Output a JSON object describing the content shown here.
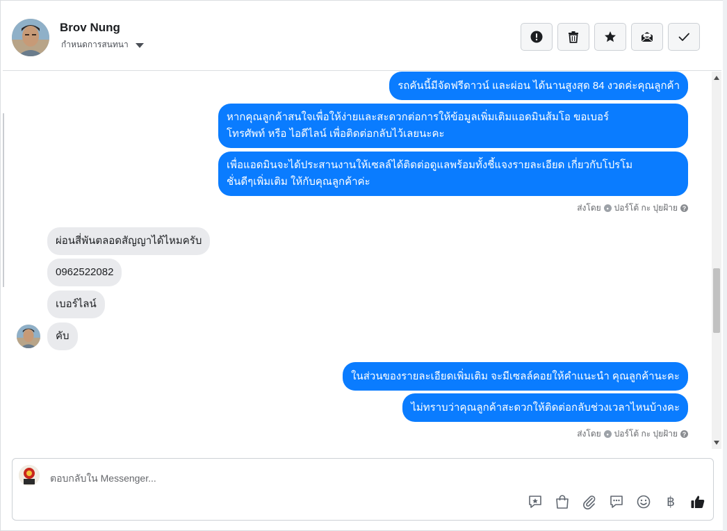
{
  "header": {
    "contact_name": "Brov Nung",
    "assign_label": "กำหนดการสนทนา",
    "actions": [
      {
        "name": "mark-spam",
        "icon": "exclamation-icon"
      },
      {
        "name": "delete",
        "icon": "trash-icon"
      },
      {
        "name": "star",
        "icon": "star-icon"
      },
      {
        "name": "mark-unread",
        "icon": "envelope-icon"
      },
      {
        "name": "mark-done",
        "icon": "check-icon"
      }
    ]
  },
  "messages": {
    "out1": "รถคันนี้มีจัดฟรีดาวน์ และผ่อน ได้นานสูงสุด 84 งวดค่ะคุณลูกค้า",
    "out2_line1": "หากคุณลูกค้าสนใจเพื่อให้ง่ายและสะดวกต่อการให้ข้อมูลเพิ่มเติมแอดมินส้มโอ ขอเบอร์",
    "out2_line2": "โทรศัพท์ หรือ ไอดีไลน์ เพื่อติดต่อกลับไว้เลยนะคะ",
    "out3_line1": "เพื่อแอดมินจะได้ประสานงานให้เซลล์ได้ติดต่อดูแลพร้อมทั้งชี้แจงรายละเอียด เกี่ยวกับโปรโม",
    "out3_line2": "ชั่นดีๆเพิ่มเติม ให้กับคุณลูกค้าค่ะ",
    "sent_by_1": "ส่งโดย",
    "sent_by_1_name": "ปอร์โต้ กะ ปุยฝ้าย",
    "in1": "ผ่อนสี่พันตลอดสัญญาได้ไหมครับ",
    "in2": "0962522082",
    "in3": "เบอร์ไลน์",
    "in4": "คับ",
    "out4": "ในส่วนของรายละเอียดเพิ่มเติม จะมีเซลล์คอยให้คำแนะนำ คุณลูกค้านะคะ",
    "out5": "ไม่ทราบว่าคุณลูกค้าสะดวกให้ติดต่อกลับช่วงเวลาไหนบ้างคะ",
    "sent_by_2": "ส่งโดย",
    "sent_by_2_name": "ปอร์โต้ กะ ปุยฝ้าย"
  },
  "composer": {
    "placeholder": "ตอบกลับใน Messenger...",
    "tools": [
      "saved-reply-icon",
      "shop-bag-icon",
      "attachment-icon",
      "chat-bubble-icon",
      "emoji-icon",
      "baht-icon",
      "thumbs-up-icon"
    ],
    "baht_symbol": "฿"
  },
  "colors": {
    "outgoing_bubble": "#0a7cff",
    "incoming_bubble": "#e9eaed",
    "thumbs_up": "#1c1e21"
  }
}
